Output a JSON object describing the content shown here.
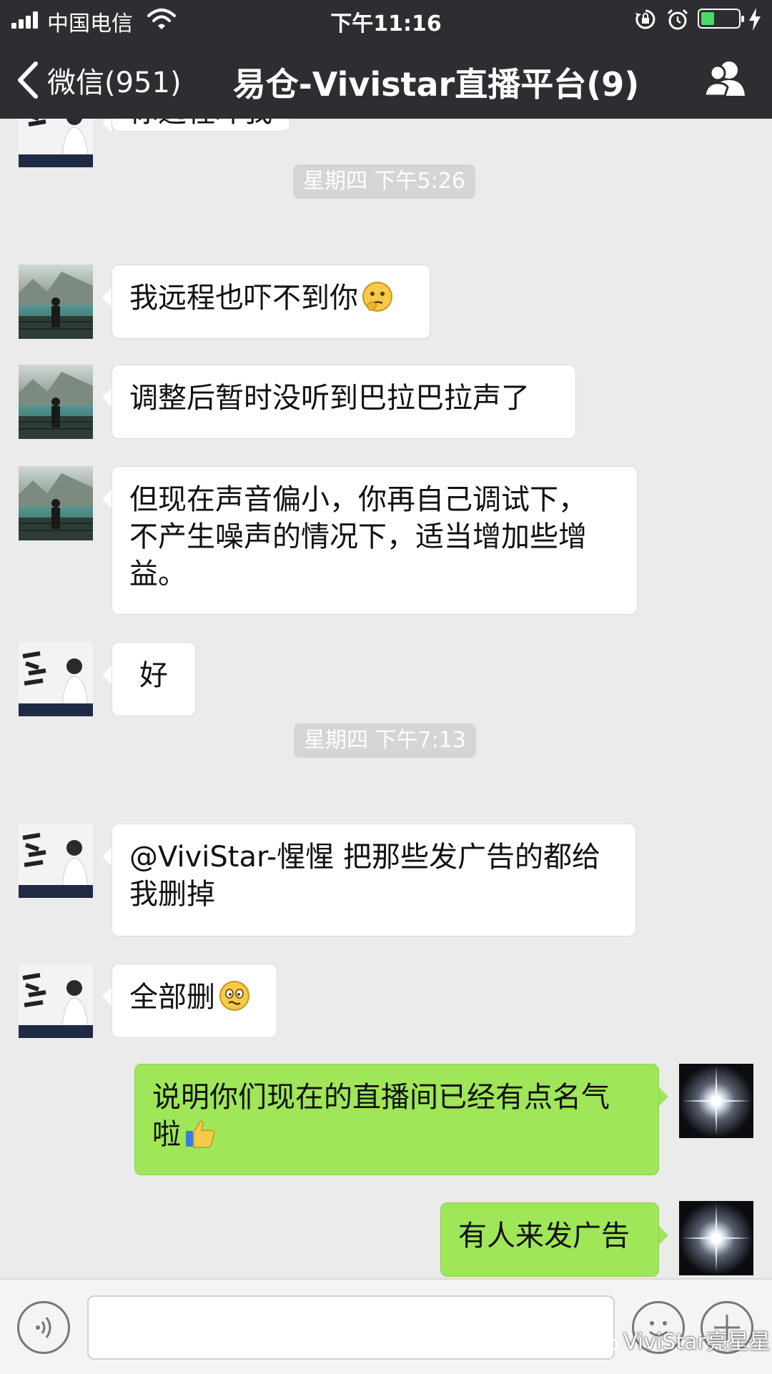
{
  "status_bar": {
    "carrier": "中国电信",
    "time": "下午11:16"
  },
  "nav": {
    "back_label": "微信(951)",
    "title": "易仓-Vivistar直播平台(9)"
  },
  "chat": {
    "partial_message": "你远程吓我",
    "timestamps": [
      "星期四 下午5:26",
      "星期四 下午7:13"
    ],
    "messages": [
      {
        "sender": "other",
        "text": "我远程也吓不到你",
        "emoji": "thinking"
      },
      {
        "sender": "other",
        "text": "调整后暂时没听到巴拉巴拉声了"
      },
      {
        "sender": "other",
        "lines": [
          "但现在声音偏小，你再自己调试下，",
          "不产生噪声的情况下，适当增加些增",
          "益。"
        ]
      },
      {
        "sender": "other2",
        "text": "好"
      },
      {
        "sender": "other2",
        "lines": [
          "@ViviStar-惺惺 把那些发广告的都给",
          "我删掉"
        ]
      },
      {
        "sender": "other2",
        "text": "全部删",
        "emoji": "woozy"
      },
      {
        "sender": "me",
        "lines": [
          "说明你们现在的直播间已经有点名气",
          "啦"
        ],
        "emoji": "thumbs-up"
      },
      {
        "sender": "me",
        "text": "有人来发广告"
      }
    ]
  },
  "watermark": "ViviStar亮星星",
  "colors": {
    "nav_bg": "#2e2e32",
    "chat_bg": "#ebebeb",
    "bubble_in": "#ffffff",
    "bubble_out": "#9fe658",
    "timestamp_bg": "#d5d5d5",
    "battery_fill": "#4cd964"
  },
  "icons": [
    "signal-icon",
    "wifi-icon",
    "lock-rotation-icon",
    "alarm-icon",
    "battery-icon",
    "charging-icon",
    "back-chevron-icon",
    "group-members-icon",
    "voice-icon",
    "emoji-icon",
    "plus-icon",
    "wechat-icon"
  ]
}
